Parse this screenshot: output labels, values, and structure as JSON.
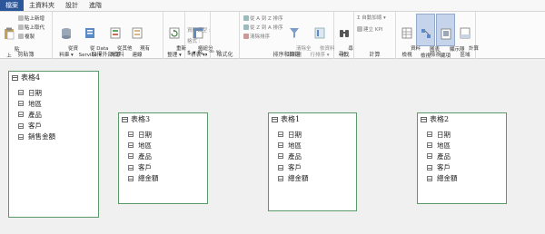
{
  "tabs": [
    "檔案",
    "主資料夾",
    "設計",
    "進階"
  ],
  "ribbon": {
    "clipboard": {
      "paste": "貼\n上",
      "small": [
        "貼上新增",
        "貼上取代",
        "複製"
      ],
      "label": "剪貼簿"
    },
    "external": {
      "buttons": [
        "從資\n料庫 ▾",
        "從 Data\nService ▾",
        "從其他\n來源",
        "現有\n連線"
      ],
      "label": "取得外部資料"
    },
    "refresh": {
      "button": "重新\n整理 ▾"
    },
    "pivot": {
      "button": "樞紐分\n析表 ▾"
    },
    "format": {
      "rows": [
        "資料類型 :",
        "格式 :",
        "$ ▾ % ❟ ⁰⁰ ⁰⁰"
      ],
      "label": "格式化"
    },
    "sortfilter": {
      "rows": [
        "從 A 到 Z 排序",
        "從 Z 到 A 排序",
        "清除排序"
      ],
      "btn_clear": "清除全\n部篩選",
      "btn_bycol": "依資料\n行排序 ▾",
      "label": "排序和篩選"
    },
    "find": {
      "button": "尋\n找",
      "label": "尋找"
    },
    "calc": {
      "rows": [
        "Σ 自動加總 ▾",
        "建立 KPI"
      ],
      "label": "計算"
    },
    "view": {
      "buttons": [
        "資料\n檢視",
        "圖表\n檢視",
        "顯示隱\n藏項",
        "計算\n區域"
      ],
      "label": "檢視"
    }
  },
  "tables": [
    {
      "name": "表格4",
      "fields": [
        "日期",
        "地區",
        "產品",
        "客戶",
        "銷售金額"
      ]
    },
    {
      "name": "表格3",
      "fields": [
        "日期",
        "地區",
        "產品",
        "客戶",
        "總金額"
      ]
    },
    {
      "name": "表格1",
      "fields": [
        "日期",
        "地區",
        "產品",
        "客戶",
        "總金額"
      ]
    },
    {
      "name": "表格2",
      "fields": [
        "日期",
        "地區",
        "產品",
        "客戶",
        "總金額"
      ]
    }
  ]
}
